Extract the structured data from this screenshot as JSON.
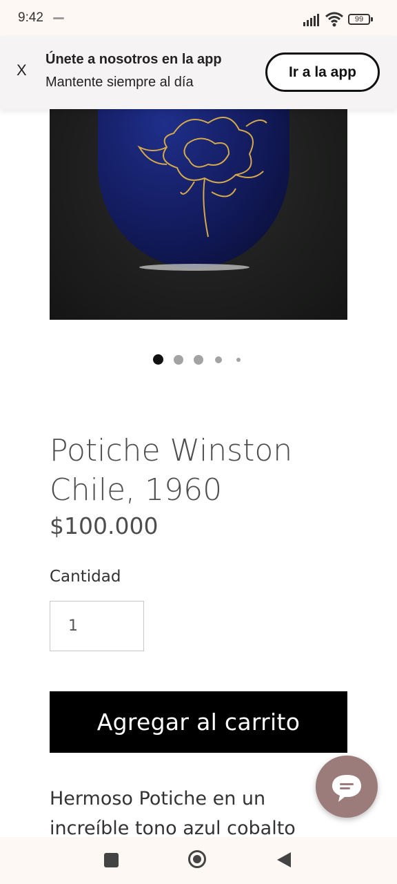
{
  "status_bar": {
    "time": "9:42",
    "battery": "99"
  },
  "app_banner": {
    "close_label": "X",
    "title": "Únete a nosotros en la app",
    "subtitle": "Mantente siempre al día",
    "button_label": "Ir a la app"
  },
  "carousel": {
    "total": 5,
    "active_index": 0
  },
  "product": {
    "title": "Potiche Winston Chile, 1960",
    "price": "$100.000",
    "quantity_label": "Cantidad",
    "quantity_value": "1",
    "add_to_cart_label": "Agregar al carrito",
    "description": "Hermoso Potiche en un increíble tono azul cobalto"
  },
  "colors": {
    "cart_button": "#000000",
    "chat_fab": "#9b7c7b",
    "vase": "#121a5a",
    "gold": "#d6a94a"
  },
  "icons": {
    "chat": "chat-bubble-icon",
    "nav_recents": "square-icon",
    "nav_home": "circle-icon",
    "nav_back": "triangle-back-icon"
  }
}
